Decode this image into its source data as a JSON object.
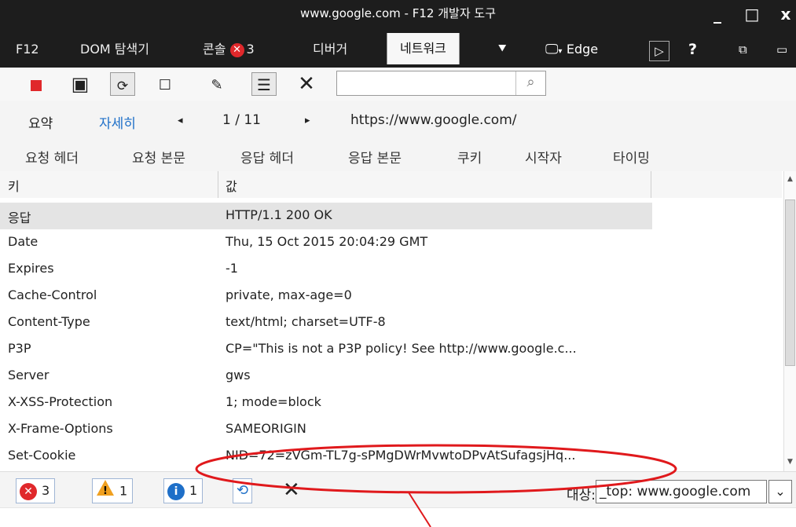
{
  "window": {
    "title": "www.google.com - F12 개발자 도구",
    "controls": [
      "_",
      "□",
      "x"
    ]
  },
  "tabs": {
    "f12": "F12",
    "dom": "DOM 탐색기",
    "console": "콘솔",
    "console_count": "3",
    "debugger": "디버거",
    "network": "네트워크",
    "emulation": "Edge",
    "help": "?"
  },
  "toolbar": {
    "search_placeholder": ""
  },
  "summary": {
    "summary_label": "요약",
    "detail_label": "자세히",
    "prev": "◂",
    "page": "1 / 11",
    "next": "▸",
    "url": "https://www.google.com/"
  },
  "detail_tabs": [
    "요청 헤더",
    "요청 본문",
    "응답 헤더",
    "응답 본문",
    "쿠키",
    "시작자",
    "타이밍"
  ],
  "headers_table": {
    "col_key": "키",
    "col_value": "값",
    "rows": [
      {
        "key": "응답",
        "value": "HTTP/1.1 200 OK"
      },
      {
        "key": "Date",
        "value": "Thu, 15 Oct 2015 20:04:29 GMT"
      },
      {
        "key": "Expires",
        "value": "-1"
      },
      {
        "key": "Cache-Control",
        "value": "private, max-age=0"
      },
      {
        "key": "Content-Type",
        "value": "text/html; charset=UTF-8"
      },
      {
        "key": "P3P",
        "value": "CP=\"This is not a P3P policy! See http://www.google.c..."
      },
      {
        "key": "Server",
        "value": "gws"
      },
      {
        "key": "X-XSS-Protection",
        "value": "1; mode=block"
      },
      {
        "key": "X-Frame-Options",
        "value": "SAMEORIGIN"
      },
      {
        "key": "Set-Cookie",
        "value": "NID=72=zVGm-TL7g-sPMgDWrMvwtoDPvAtSufagsjHq..."
      }
    ]
  },
  "console_bar": {
    "errors": "3",
    "warnings": "1",
    "info": "1",
    "target_label": "대상:",
    "target_value": "_top: www.google.com"
  },
  "colors": {
    "dark_bar": "#1d1d1d",
    "error_red": "#e0282b",
    "warning_orange": "#f0a020",
    "info_blue": "#1e6fc8",
    "link_blue": "#1e6fc8",
    "annotation_red": "#e0191c"
  }
}
